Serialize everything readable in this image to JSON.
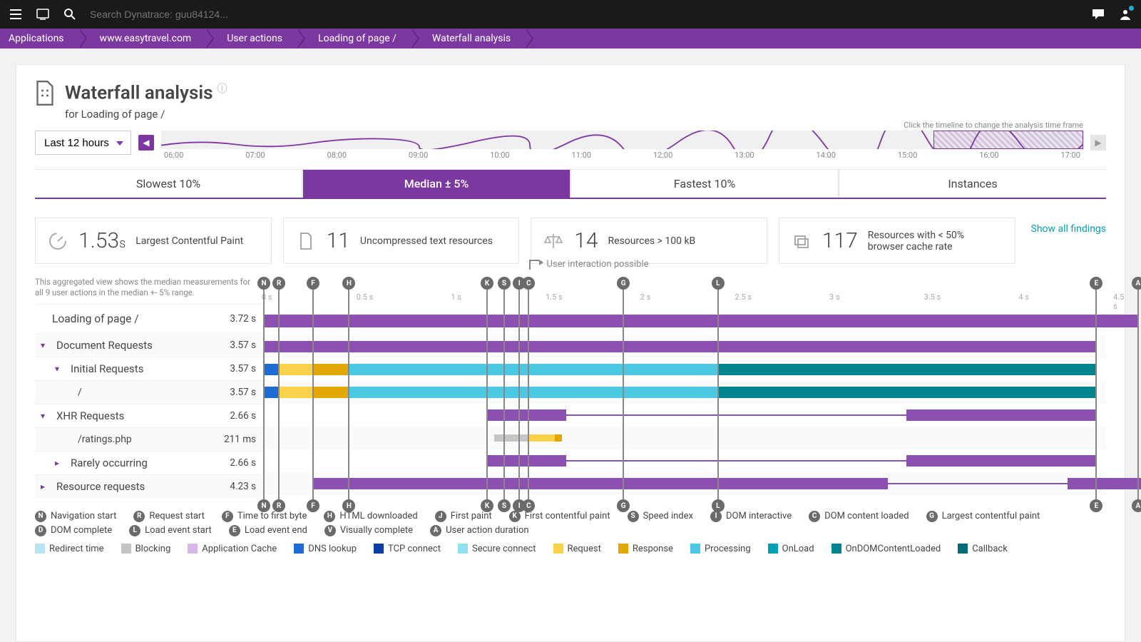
{
  "topbar": {
    "search_placeholder": "Search Dynatrace: guu84124..."
  },
  "breadcrumb": [
    "Applications",
    "www.easytravel.com",
    "User actions",
    "Loading of page /",
    "Waterfall analysis"
  ],
  "page": {
    "title": "Waterfall analysis",
    "subtitle": "for Loading of page /"
  },
  "timeline": {
    "range_label": "Last 12 hours",
    "hint": "Click the timeline to change the analysis time frame",
    "ticks": [
      "06:00",
      "07:00",
      "08:00",
      "09:00",
      "10:00",
      "11:00",
      "12:00",
      "13:00",
      "14:00",
      "15:00",
      "16:00",
      "17:00"
    ]
  },
  "tabs": {
    "items": [
      "Slowest 10%",
      "Median ± 5%",
      "Fastest 10%",
      "Instances"
    ],
    "active_index": 1
  },
  "kpis": [
    {
      "value": "1.53",
      "unit": "s",
      "label": "Largest Contentful Paint",
      "icon": "gauge"
    },
    {
      "value": "11",
      "unit": "",
      "label": "Uncompressed text resources",
      "icon": "file"
    },
    {
      "value": "14",
      "unit": "",
      "label": "Resources > 100 kB",
      "icon": "scale"
    },
    {
      "value": "117",
      "unit": "",
      "label": "Resources with < 50% browser cache rate",
      "icon": "stack"
    }
  ],
  "kpi_link": "Show all findings",
  "aggregation_note": "This aggregated view shows the median measurements for all 9 user actions in the median +- 5% range.",
  "annotation": "User interaction possible",
  "chart_data": {
    "type": "waterfall-gantt",
    "x_unit": "s",
    "xlim": [
      0,
      4.5
    ],
    "ticks": [
      0,
      0.5,
      1,
      1.5,
      2,
      2.5,
      3,
      3.5,
      4,
      4.5
    ],
    "tick_labels": [
      "0 s",
      "0.5 s",
      "1 s",
      "1.5 s",
      "2 s",
      "2.5 s",
      "3 s",
      "3.5 s",
      "4 s",
      "4.5 s"
    ],
    "markers": [
      {
        "id": "N",
        "label": "Navigation start",
        "t": 0.0
      },
      {
        "id": "R",
        "label": "Request start",
        "t": 0.08
      },
      {
        "id": "F",
        "label": "Time to first byte",
        "t": 0.26
      },
      {
        "id": "H",
        "label": "HTML downloaded",
        "t": 0.45
      },
      {
        "id": "K",
        "label": "First contentful paint",
        "t": 1.18
      },
      {
        "id": "S",
        "label": "Speed index",
        "t": 1.27
      },
      {
        "id": "I",
        "label": "DOM interactive",
        "t": 1.35
      },
      {
        "id": "C",
        "label": "DOM content loaded",
        "t": 1.4
      },
      {
        "id": "G",
        "label": "Largest contentful paint",
        "t": 1.9
      },
      {
        "id": "L",
        "label": "Load event start",
        "t": 2.4
      },
      {
        "id": "E",
        "label": "Load event end",
        "t": 4.4
      },
      {
        "id": "A",
        "label": "User action duration",
        "t": 4.62
      }
    ],
    "annotation_at": 1.4,
    "rows": [
      {
        "name": "Loading of page /",
        "duration": "3.72 s",
        "indent": 0,
        "head": true,
        "segments": [
          {
            "color": "purple",
            "from": 0.0,
            "to": 4.62
          }
        ]
      },
      {
        "name": "Document Requests",
        "duration": "3.57 s",
        "indent": 0,
        "caret": "down",
        "segments": [
          {
            "color": "purple",
            "from": 0.0,
            "to": 4.4
          }
        ]
      },
      {
        "name": "Initial Requests",
        "duration": "3.57 s",
        "indent": 1,
        "caret": "down",
        "segments": [
          {
            "color": "blue",
            "from": 0.0,
            "to": 0.08
          },
          {
            "color": "yellow",
            "from": 0.08,
            "to": 0.26
          },
          {
            "color": "yellow2",
            "from": 0.26,
            "to": 0.45
          },
          {
            "color": "cyan",
            "from": 0.45,
            "to": 2.4
          },
          {
            "color": "teal",
            "from": 2.4,
            "to": 4.4
          }
        ]
      },
      {
        "name": "/",
        "duration": "3.57 s",
        "indent": 2,
        "segments": [
          {
            "color": "blue",
            "from": 0.0,
            "to": 0.08
          },
          {
            "color": "yellow",
            "from": 0.08,
            "to": 0.26
          },
          {
            "color": "yellow2",
            "from": 0.26,
            "to": 0.45
          },
          {
            "color": "cyan",
            "from": 0.45,
            "to": 2.4
          },
          {
            "color": "teal",
            "from": 2.4,
            "to": 4.4
          }
        ]
      },
      {
        "name": "XHR Requests",
        "duration": "2.66 s",
        "indent": 0,
        "caret": "down",
        "segments": [
          {
            "color": "purple",
            "from": 1.18,
            "to": 1.6
          },
          {
            "type": "line",
            "from": 1.6,
            "to": 3.4
          },
          {
            "color": "purple",
            "from": 3.4,
            "to": 4.4
          }
        ]
      },
      {
        "name": "/ratings.php",
        "duration": "211 ms",
        "indent": 2,
        "segments": [
          {
            "color": "gray",
            "from": 1.22,
            "to": 1.4,
            "style": "tiny"
          },
          {
            "color": "yellow",
            "from": 1.4,
            "to": 1.54,
            "style": "tiny"
          },
          {
            "color": "yellow2",
            "from": 1.54,
            "to": 1.58,
            "style": "tiny"
          }
        ]
      },
      {
        "name": "Rarely occurring",
        "duration": "2.66 s",
        "indent": 1,
        "caret": "right",
        "segments": [
          {
            "color": "purple",
            "from": 1.18,
            "to": 1.6
          },
          {
            "type": "line",
            "from": 1.6,
            "to": 3.4
          },
          {
            "color": "purple",
            "from": 3.4,
            "to": 4.4
          }
        ]
      },
      {
        "name": "Resource requests",
        "duration": "4.23 s",
        "indent": 0,
        "caret": "right",
        "segments": [
          {
            "color": "purple",
            "from": 0.26,
            "to": 3.3
          },
          {
            "type": "line",
            "from": 3.3,
            "to": 4.25
          },
          {
            "color": "purple",
            "from": 4.25,
            "to": 4.65
          },
          {
            "type": "line",
            "from": 4.65,
            "to": 5.55,
            "endcap": true
          }
        ]
      }
    ]
  },
  "legend_markers": [
    {
      "b": "N",
      "t": "Navigation start"
    },
    {
      "b": "R",
      "t": "Request start"
    },
    {
      "b": "F",
      "t": "Time to first byte"
    },
    {
      "b": "H",
      "t": "HTML downloaded"
    },
    {
      "b": "J",
      "t": "First paint"
    },
    {
      "b": "K",
      "t": "First contentful paint"
    },
    {
      "b": "S",
      "t": "Speed index"
    },
    {
      "b": "I",
      "t": "DOM interactive"
    },
    {
      "b": "C",
      "t": "DOM content loaded"
    },
    {
      "b": "G",
      "t": "Largest contentful paint"
    },
    {
      "b": "D",
      "t": "DOM complete"
    },
    {
      "b": "L",
      "t": "Load event start"
    },
    {
      "b": "E",
      "t": "Load event end"
    },
    {
      "b": "V",
      "t": "Visually complete"
    },
    {
      "b": "A",
      "t": "User action duration"
    }
  ],
  "legend_colors": [
    {
      "c": "redirect",
      "t": "Redirect time"
    },
    {
      "c": "blocking",
      "t": "Blocking"
    },
    {
      "c": "appcache",
      "t": "Application Cache"
    },
    {
      "c": "dns",
      "t": "DNS lookup"
    },
    {
      "c": "tcp",
      "t": "TCP connect"
    },
    {
      "c": "secure",
      "t": "Secure connect"
    },
    {
      "c": "request",
      "t": "Request"
    },
    {
      "c": "response",
      "t": "Response"
    },
    {
      "c": "processing",
      "t": "Processing"
    },
    {
      "c": "onload",
      "t": "OnLoad"
    },
    {
      "c": "ondom",
      "t": "OnDOMContentLoaded"
    },
    {
      "c": "callback",
      "t": "Callback"
    }
  ]
}
